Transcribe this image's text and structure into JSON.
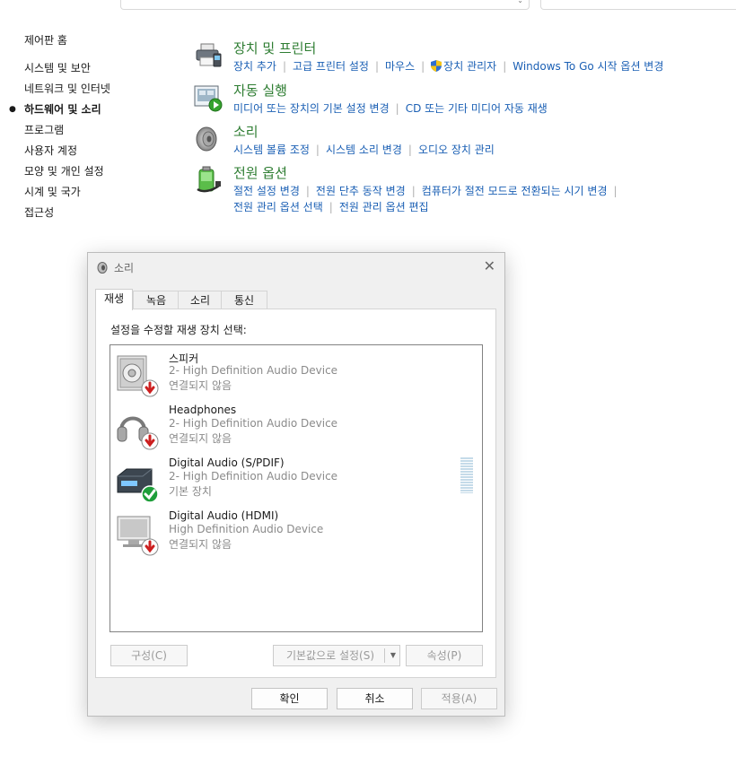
{
  "sidebar": {
    "items": [
      {
        "label": "제어판 홈"
      },
      {
        "label": "시스템 및 보안"
      },
      {
        "label": "네트워크 및 인터넷"
      },
      {
        "label": "하드웨어 및 소리",
        "active": true
      },
      {
        "label": "프로그램"
      },
      {
        "label": "사용자 계정"
      },
      {
        "label": "모양 및 개인 설정"
      },
      {
        "label": "시계 및 국가"
      },
      {
        "label": "접근성"
      }
    ]
  },
  "categories": [
    {
      "title": "장치 및 프린터",
      "icon": "printer-icon",
      "links": [
        "장치 추가",
        "고급 프린터 설정",
        "마우스",
        "장치 관리자",
        "Windows To Go 시작 옵션 변경"
      ]
    },
    {
      "title": "자동 실행",
      "icon": "autoplay-icon",
      "links": [
        "미디어 또는 장치의 기본 설정 변경",
        "CD 또는 기타 미디어 자동 재생"
      ]
    },
    {
      "title": "소리",
      "icon": "speaker-icon",
      "links": [
        "시스템 볼륨 조정",
        "시스템 소리 변경",
        "오디오 장치 관리"
      ]
    },
    {
      "title": "전원 옵션",
      "icon": "power-icon",
      "links": [
        "절전 설정 변경",
        "전원 단추 동작 변경",
        "컴퓨터가 절전 모드로 전환되는 시기 변경",
        "전원 관리 옵션 선택",
        "전원 관리 옵션 편집"
      ]
    }
  ],
  "dialog": {
    "title": "소리",
    "tabs": [
      "재생",
      "녹음",
      "소리",
      "통신"
    ],
    "instruction": "설정을 수정할 재생 장치 선택:",
    "devices": [
      {
        "name": "스피커",
        "sub": "2- High Definition Audio Device",
        "status": "연결되지 않음",
        "icon": "speaker-device-icon",
        "badge": "disconnected-icon"
      },
      {
        "name": "Headphones",
        "sub": "2- High Definition Audio Device",
        "status": "연결되지 않음",
        "icon": "headphones-device-icon",
        "badge": "disconnected-icon"
      },
      {
        "name": "Digital Audio (S/PDIF)",
        "sub": "2- High Definition Audio Device",
        "status": "기본 장치",
        "icon": "spdif-device-icon",
        "badge": "default-check-icon"
      },
      {
        "name": "Digital Audio (HDMI)",
        "sub": "High Definition Audio Device",
        "status": "연결되지 않음",
        "icon": "monitor-device-icon",
        "badge": "disconnected-icon"
      }
    ],
    "buttons": {
      "configure": "구성(C)",
      "set_default": "기본값으로 설정(S)",
      "properties": "속성(P)",
      "ok": "확인",
      "cancel": "취소",
      "apply": "적용(A)"
    }
  },
  "colors": {
    "category_title": "#2e7d32",
    "link": "#1a5fb4",
    "muted": "#8a8a8a"
  }
}
